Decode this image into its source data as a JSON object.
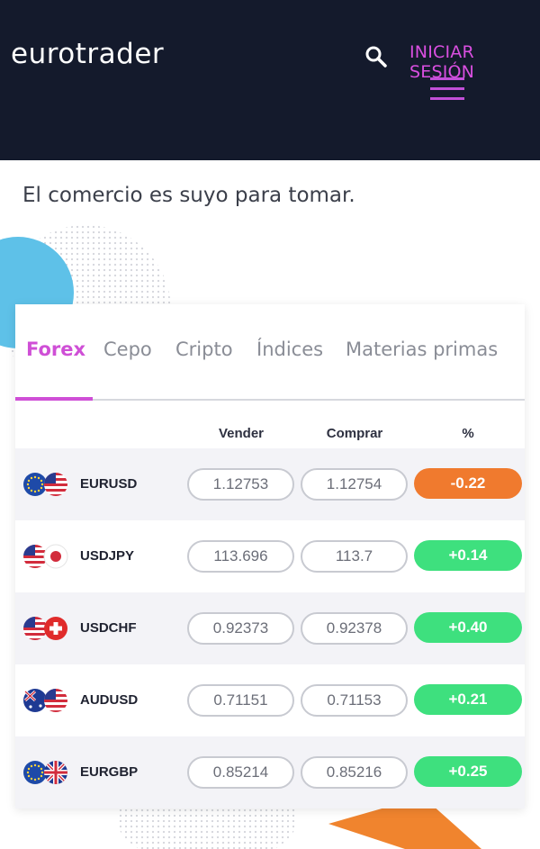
{
  "header": {
    "logo": "eurotrader",
    "login_label": "INICIAR SESIÓN",
    "icons": [
      "search-icon",
      "menu-icon"
    ]
  },
  "tagline": "El comercio es suyo para tomar.",
  "tabs": [
    {
      "label": "Forex",
      "active": true
    },
    {
      "label": "Cepo",
      "active": false
    },
    {
      "label": "Cripto",
      "active": false
    },
    {
      "label": "Índices",
      "active": false
    },
    {
      "label": "Materias primas",
      "active": false
    }
  ],
  "columns": {
    "sell": "Vender",
    "buy": "Comprar",
    "pct": "%"
  },
  "rows": [
    {
      "pair": "EURUSD",
      "sell": "1.12753",
      "buy": "1.12754",
      "pct": "-0.22",
      "dir": "down",
      "flags": [
        "eu-flag",
        "us-flag"
      ]
    },
    {
      "pair": "USDJPY",
      "sell": "113.696",
      "buy": "113.7",
      "pct": "+0.14",
      "dir": "up",
      "flags": [
        "us-flag",
        "jp-flag"
      ]
    },
    {
      "pair": "USDCHF",
      "sell": "0.92373",
      "buy": "0.92378",
      "pct": "+0.40",
      "dir": "up",
      "flags": [
        "us-flag",
        "ch-flag"
      ]
    },
    {
      "pair": "AUDUSD",
      "sell": "0.71151",
      "buy": "0.71153",
      "pct": "+0.21",
      "dir": "up",
      "flags": [
        "au-flag",
        "us-flag"
      ]
    },
    {
      "pair": "EURGBP",
      "sell": "0.85214",
      "buy": "0.85216",
      "pct": "+0.25",
      "dir": "up",
      "flags": [
        "eu-flag",
        "gb-flag"
      ]
    }
  ],
  "colors": {
    "header_bg": "#141a2c",
    "accent": "#cf4fd6",
    "up": "#3ee07e",
    "down": "#f07a2e"
  }
}
